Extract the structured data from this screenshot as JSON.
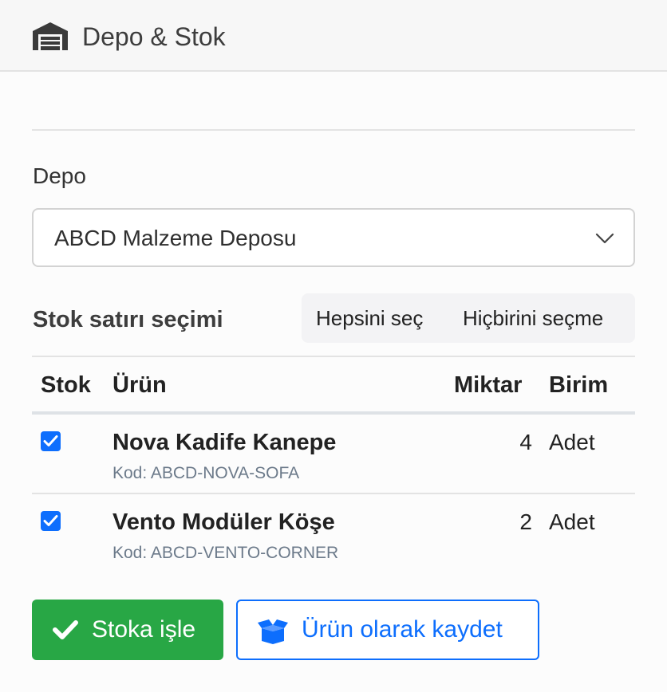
{
  "header": {
    "title": "Depo & Stok",
    "icon": "warehouse-icon"
  },
  "depo": {
    "label": "Depo",
    "selected": "ABCD Malzeme Deposu"
  },
  "stock_selection": {
    "title": "Stok satırı seçimi",
    "select_all": "Hepsini seç",
    "select_none": "Hiçbirini seçme"
  },
  "table": {
    "headers": {
      "stok": "Stok",
      "urun": "Ürün",
      "miktar": "Miktar",
      "birim": "Birim"
    },
    "rows": [
      {
        "checked": true,
        "name": "Nova Kadife Kanepe",
        "code": "Kod: ABCD-NOVA-SOFA",
        "qty": "4",
        "unit": "Adet"
      },
      {
        "checked": true,
        "name": "Vento Modüler Köşe",
        "code": "Kod: ABCD-VENTO-CORNER",
        "qty": "2",
        "unit": "Adet"
      }
    ]
  },
  "actions": {
    "process": "Stoka işle",
    "save_as_product": "Ürün olarak kaydet"
  },
  "colors": {
    "primary": "#0d6efd",
    "success": "#28a745"
  }
}
